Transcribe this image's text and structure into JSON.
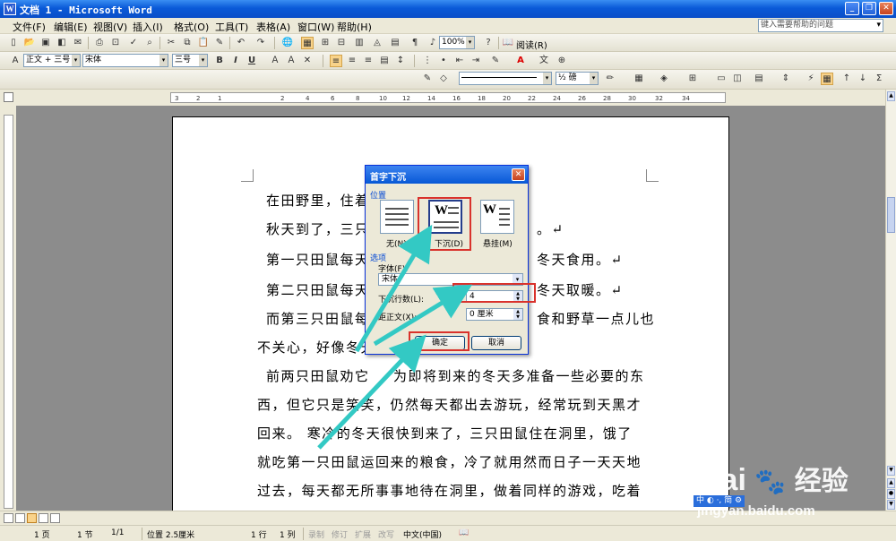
{
  "window": {
    "title": "文档 1 - Microsoft Word",
    "minimize": "_",
    "restore": "❐",
    "close": "✕"
  },
  "menu": {
    "items": [
      "文件(F)",
      "编辑(E)",
      "视图(V)",
      "插入(I)",
      "格式(O)",
      "工具(T)",
      "表格(A)",
      "窗口(W)",
      "帮助(H)"
    ],
    "help_placeholder": "键入需要帮助的问题"
  },
  "toolbar_standard": {
    "zoom": "100%",
    "read_label": "阅读(R)"
  },
  "toolbar_format": {
    "style": "正文 + 三号",
    "font": "宋体",
    "size": "三号",
    "bold": "B",
    "italic": "I",
    "underline": "U"
  },
  "toolbar_drawing": {
    "line_weight": "½ 磅"
  },
  "ruler": {
    "ticks": [
      "3",
      "2",
      "1",
      "",
      "2",
      "4",
      "6",
      "8",
      "10",
      "12",
      "14",
      "16",
      "18",
      "20",
      "22",
      "24",
      "26",
      "28",
      "30",
      "32",
      "34"
    ]
  },
  "document": {
    "lines": [
      {
        "text": "在田野里，住着",
        "para": ""
      },
      {
        "text": "秋天到了，三只",
        "para": ""
      },
      {
        "text": "第一只田鼠每天",
        "para": ""
      },
      {
        "text": "第二只田鼠每天",
        "para": ""
      },
      {
        "text": "而第三只田鼠每",
        "para": ""
      },
      {
        "text": "不关心，好像冬天",
        "para": ""
      },
      {
        "text": "前两只田鼠劝它",
        "para": ""
      },
      {
        "text": "西，但它只是笑笑，仍然每天都出去游玩，经常玩到天黑才",
        "para": ""
      },
      {
        "text": "回来。 寒冷的冬天很快到来了，三只田鼠住在洞里，饿了",
        "para": ""
      },
      {
        "text": "就吃第一只田鼠运回来的粮食，冷了就用然而日子一天天地",
        "para": ""
      },
      {
        "text": "过去，每天都无所事事地待在洞里，做着同样的游戏，吃着",
        "para": ""
      }
    ],
    "right_fragments": [
      {
        "text": "。↵"
      },
      {
        "text": "冬天食用。↵"
      },
      {
        "text": "冬天取暖。↵"
      },
      {
        "text": "食和野草一点儿也"
      },
      {
        "text": "为即将到来的冬天多准备一些必要的东"
      }
    ]
  },
  "dialog": {
    "title": "首字下沉",
    "position_group": "位置",
    "opt_none": "无(N)",
    "opt_dropped": "下沉(D)",
    "opt_margin": "悬挂(M)",
    "options_group": "选项",
    "font_label": "字体(F):",
    "font_value": "宋体",
    "lines_label": "下沉行数(L):",
    "lines_value": "4",
    "distance_label": "距正文(X):",
    "distance_value": "0 厘米",
    "ok": "确定",
    "cancel": "取消"
  },
  "status": {
    "page": "1 页",
    "section": "1 节",
    "page_of": "1/1",
    "position": "位置 2.5厘米",
    "line": "1 行",
    "column": "1 列",
    "rec": "录制",
    "trk": "修订",
    "ext": "扩展",
    "ovr": "改写",
    "language": "中文(中国)"
  },
  "watermark": {
    "brand": "Bai",
    "brand2": "经验",
    "url": "jingyan.baidu.com"
  },
  "ime": {
    "text": "中 ◐ ·, 简 ⚙"
  },
  "colors": {
    "accent_highlight": "#d9322c",
    "arrow": "#33c9c4",
    "title_blue": "#0a5ad8"
  }
}
